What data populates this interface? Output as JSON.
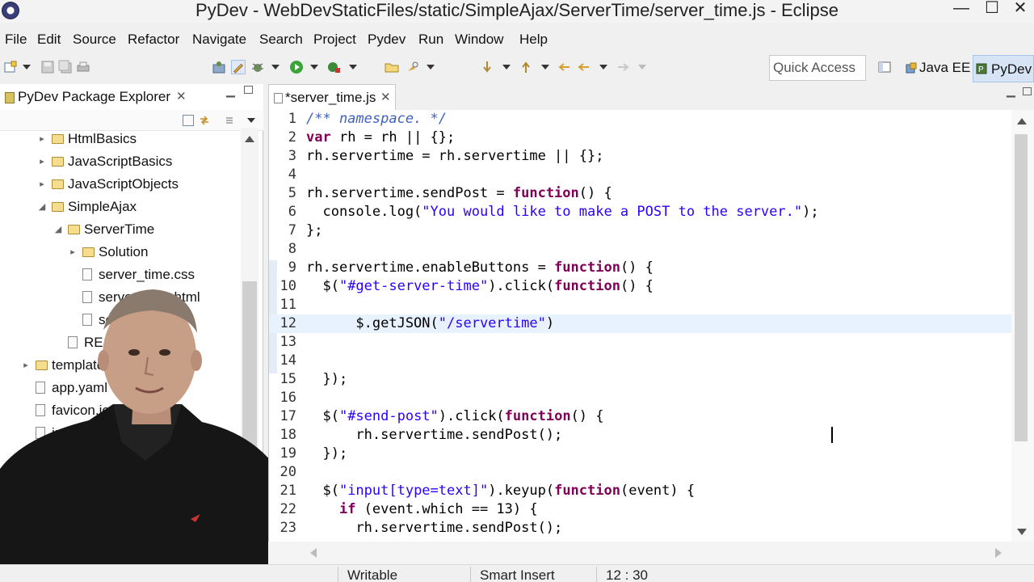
{
  "window": {
    "title": "PyDev - WebDevStaticFiles/static/SimpleAjax/ServerTime/server_time.js - Eclipse",
    "minimize": "—",
    "maximize": "☐",
    "close": "✕"
  },
  "menu": [
    "File",
    "Edit",
    "Source",
    "Refactor",
    "Navigate",
    "Search",
    "Project",
    "Pydev",
    "Run",
    "Window",
    "Help"
  ],
  "toolbar": {
    "quick_access": "Quick Access",
    "perspectives": [
      {
        "label": "Java EE",
        "active": false
      },
      {
        "label": "PyDev",
        "active": true
      }
    ]
  },
  "explorer": {
    "title": "PyDev Package Explorer",
    "close": "✕",
    "tree": [
      {
        "label": "HtmlBasics",
        "kind": "folder",
        "depth": 1,
        "twisty": "▸"
      },
      {
        "label": "JavaScriptBasics",
        "kind": "folder",
        "depth": 1,
        "twisty": "▸"
      },
      {
        "label": "JavaScriptObjects",
        "kind": "folder",
        "depth": 1,
        "twisty": "▸"
      },
      {
        "label": "SimpleAjax",
        "kind": "folder",
        "depth": 1,
        "twisty": "◢"
      },
      {
        "label": "ServerTime",
        "kind": "folder",
        "depth": 2,
        "twisty": "◢"
      },
      {
        "label": "Solution",
        "kind": "folder",
        "depth": 3,
        "twisty": "▸"
      },
      {
        "label": "server_time.css",
        "kind": "file",
        "depth": 3,
        "twisty": ""
      },
      {
        "label": "server_time.html",
        "kind": "file",
        "depth": 3,
        "twisty": ""
      },
      {
        "label": "server_time.js",
        "kind": "file",
        "depth": 3,
        "twisty": ""
      },
      {
        "label": "README",
        "kind": "file",
        "depth": 2,
        "twisty": ""
      },
      {
        "label": "templates",
        "kind": "folder",
        "depth": 0,
        "twisty": "▸"
      },
      {
        "label": "app.yaml",
        "kind": "file",
        "depth": 0,
        "twisty": ""
      },
      {
        "label": "favicon.ico",
        "kind": "file",
        "depth": 0,
        "twisty": ""
      },
      {
        "label": "index.py",
        "kind": "file",
        "depth": 0,
        "twisty": ""
      }
    ]
  },
  "editor": {
    "tab_label": "*server_time.js",
    "tab_close": "✕",
    "current_line": 12,
    "lines": [
      {
        "n": "1",
        "text": "/** namespace. */"
      },
      {
        "n": "2",
        "text": "var rh = rh || {};"
      },
      {
        "n": "3",
        "text": "rh.servertime = rh.servertime || {};"
      },
      {
        "n": "4",
        "text": ""
      },
      {
        "n": "5",
        "text": "rh.servertime.sendPost = function() {"
      },
      {
        "n": "6",
        "text": "  console.log(\"You would like to make a POST to the server.\");"
      },
      {
        "n": "7",
        "text": "};"
      },
      {
        "n": "8",
        "text": ""
      },
      {
        "n": "9",
        "text": "rh.servertime.enableButtons = function() {"
      },
      {
        "n": "10",
        "text": "  $(\"#get-server-time\").click(function() {"
      },
      {
        "n": "11",
        "text": ""
      },
      {
        "n": "12",
        "text": "      $.getJSON(\"/servertime\")"
      },
      {
        "n": "13",
        "text": ""
      },
      {
        "n": "14",
        "text": ""
      },
      {
        "n": "15",
        "text": "  });"
      },
      {
        "n": "16",
        "text": ""
      },
      {
        "n": "17",
        "text": "  $(\"#send-post\").click(function() {"
      },
      {
        "n": "18",
        "text": "      rh.servertime.sendPost();"
      },
      {
        "n": "19",
        "text": "  });"
      },
      {
        "n": "20",
        "text": ""
      },
      {
        "n": "21",
        "text": "  $(\"input[type=text]\").keyup(function(event) {"
      },
      {
        "n": "22",
        "text": "    if (event.which == 13) {"
      },
      {
        "n": "23",
        "text": "      rh.servertime.sendPost();"
      }
    ]
  },
  "status": {
    "writable": "Writable",
    "insert_mode": "Smart Insert",
    "position": "12 : 30"
  },
  "colors": {
    "keyword": "#7f0055",
    "string": "#2a00ff",
    "comment": "#3f5fbf",
    "current_line": "#e8f2fe",
    "active_perspective": "#d6e4f5"
  }
}
